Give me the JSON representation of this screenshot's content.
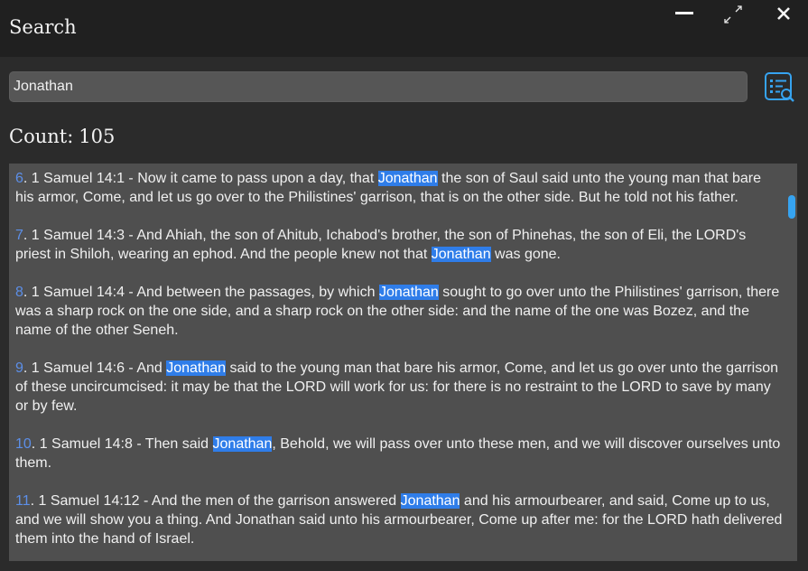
{
  "window": {
    "title": "Search",
    "minimize_icon": "minimize-icon",
    "maximize_icon": "expand-arrows-icon",
    "close_icon": "close-icon"
  },
  "search": {
    "value": "Jonathan",
    "button_icon": "list-search-icon"
  },
  "count": {
    "label": "Count:",
    "value": "105"
  },
  "results": [
    {
      "index": "6",
      "segments": [
        {
          "t": "1 Samuel 14:1 - Now it came to pass upon a day, that "
        },
        {
          "t": "Jonathan",
          "h": true
        },
        {
          "t": " the son of Saul said unto the young man that bare his armor, Come, and let us go over to the Philistines' garrison, that is on the other side. But he told not his father."
        }
      ]
    },
    {
      "index": "7",
      "segments": [
        {
          "t": "1 Samuel 14:3 - And Ahiah, the son of Ahitub, Ichabod's brother, the son of Phinehas, the son of Eli, the LORD's priest in Shiloh, wearing an ephod. And the people knew not that "
        },
        {
          "t": "Jonathan",
          "h": true
        },
        {
          "t": " was gone."
        }
      ]
    },
    {
      "index": "8",
      "segments": [
        {
          "t": "1 Samuel 14:4 - And between the passages, by which "
        },
        {
          "t": "Jonathan",
          "h": true
        },
        {
          "t": " sought to go over unto the Philistines' garrison, there was a sharp rock on the one side, and a sharp rock on the other side: and the name of the one was Bozez, and the name of the other Seneh."
        }
      ]
    },
    {
      "index": "9",
      "segments": [
        {
          "t": "1 Samuel 14:6 - And "
        },
        {
          "t": "Jonathan",
          "h": true
        },
        {
          "t": " said to the young man that bare his armor, Come, and let us go over unto the garrison of these uncircumcised: it may be that the LORD will work for us: for there is no restraint to the LORD to save by many or by few."
        }
      ]
    },
    {
      "index": "10",
      "segments": [
        {
          "t": "1 Samuel 14:8 - Then said "
        },
        {
          "t": "Jonathan",
          "h": true
        },
        {
          "t": ", Behold, we will pass over unto these men, and we will discover ourselves unto them."
        }
      ]
    },
    {
      "index": "11",
      "segments": [
        {
          "t": "1 Samuel 14:12 - And the men of the garrison answered "
        },
        {
          "t": "Jonathan",
          "h": true
        },
        {
          "t": " and his armourbearer, and said, Come up to us, and we will show you a thing. And Jonathan said unto his armourbearer, Come up after me: for the LORD hath delivered them into the hand of Israel."
        }
      ]
    }
  ],
  "scroll": {
    "position_fraction": 0.05
  },
  "colors": {
    "highlight": "#2f7de9",
    "index": "#5c8fe8",
    "accent": "#36a3f0"
  }
}
